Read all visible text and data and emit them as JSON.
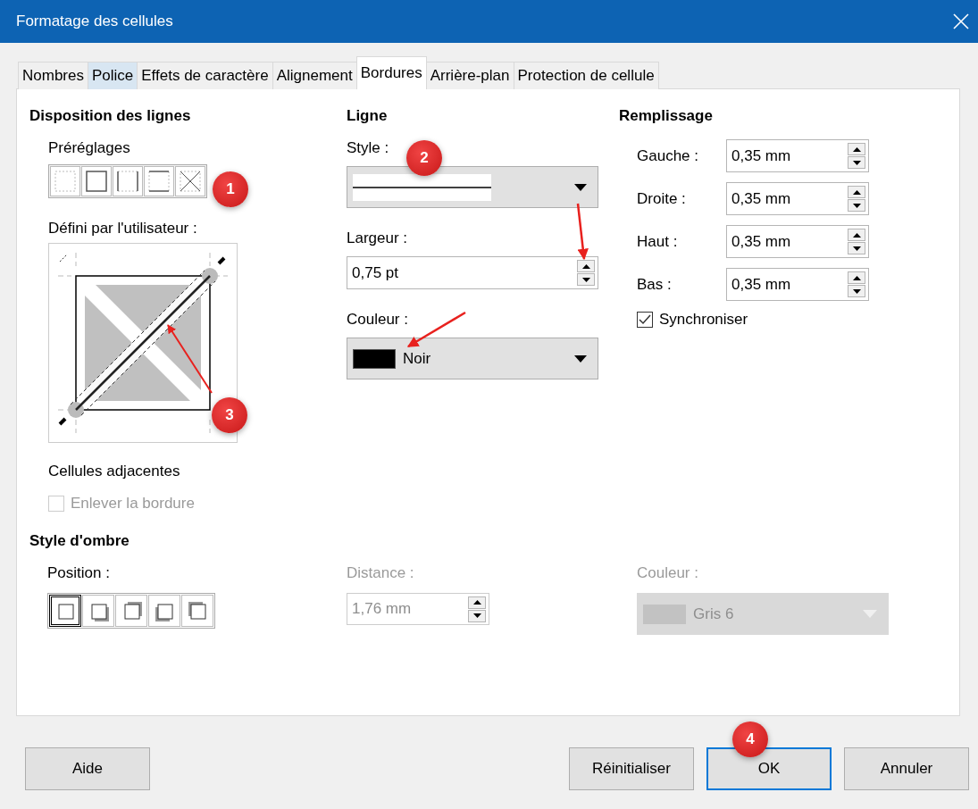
{
  "window": {
    "title": "Formatage des cellules"
  },
  "tabs": [
    {
      "label": "Nombres",
      "selected": false,
      "hovered": false
    },
    {
      "label": "Police",
      "selected": false,
      "hovered": true
    },
    {
      "label": "Effets de caractère",
      "selected": false,
      "hovered": false
    },
    {
      "label": "Alignement",
      "selected": false,
      "hovered": false
    },
    {
      "label": "Bordures",
      "selected": true,
      "hovered": false
    },
    {
      "label": "Arrière-plan",
      "selected": false,
      "hovered": false
    },
    {
      "label": "Protection de cellule",
      "selected": false,
      "hovered": false
    }
  ],
  "line_arrangement": {
    "heading": "Disposition des lignes",
    "presets_label": "Préréglages",
    "presets": [
      {
        "kind": "none"
      },
      {
        "kind": "box"
      },
      {
        "kind": "sides"
      },
      {
        "kind": "topbottom"
      },
      {
        "kind": "diagonal"
      }
    ],
    "user_defined_label": "Défini par l'utilisateur :",
    "adjacent_heading": "Cellules adjacentes",
    "remove_border": {
      "label": "Enlever la bordure",
      "checked": false,
      "disabled": true
    }
  },
  "line": {
    "heading": "Ligne",
    "style_label": "Style :",
    "width_label": "Largeur :",
    "width_value": "0,75 pt",
    "color_label": "Couleur :",
    "color": {
      "name": "Noir",
      "color": "#000000"
    }
  },
  "padding": {
    "heading": "Remplissage",
    "fields": [
      {
        "label": "Gauche :",
        "value": "0,35 mm"
      },
      {
        "label": "Droite :",
        "value": "0,35 mm"
      },
      {
        "label": "Haut :",
        "value": "0,35 mm"
      },
      {
        "label": "Bas :",
        "value": "0,35 mm"
      }
    ],
    "synchronize": {
      "label": "Synchroniser",
      "checked": true
    }
  },
  "shadow": {
    "heading": "Style d'ombre",
    "position_label": "Position :",
    "positions": [
      {
        "kind": "none",
        "selected": true
      },
      {
        "kind": "br",
        "selected": false
      },
      {
        "kind": "tr",
        "selected": false
      },
      {
        "kind": "bl",
        "selected": false
      },
      {
        "kind": "tl",
        "selected": false
      }
    ],
    "distance_label": "Distance :",
    "distance": {
      "value": "1,76 mm",
      "disabled": true
    },
    "color_label": "Couleur :",
    "color": {
      "name": "Gris 6",
      "color": "#c2c2c2",
      "disabled": true
    }
  },
  "buttons": [
    {
      "label": "Aide",
      "default": false
    },
    {
      "label": "Réinitialiser",
      "default": false
    },
    {
      "label": "OK",
      "default": true
    },
    {
      "label": "Annuler",
      "default": false
    }
  ],
  "annotations": [
    "1",
    "2",
    "3",
    "4"
  ]
}
